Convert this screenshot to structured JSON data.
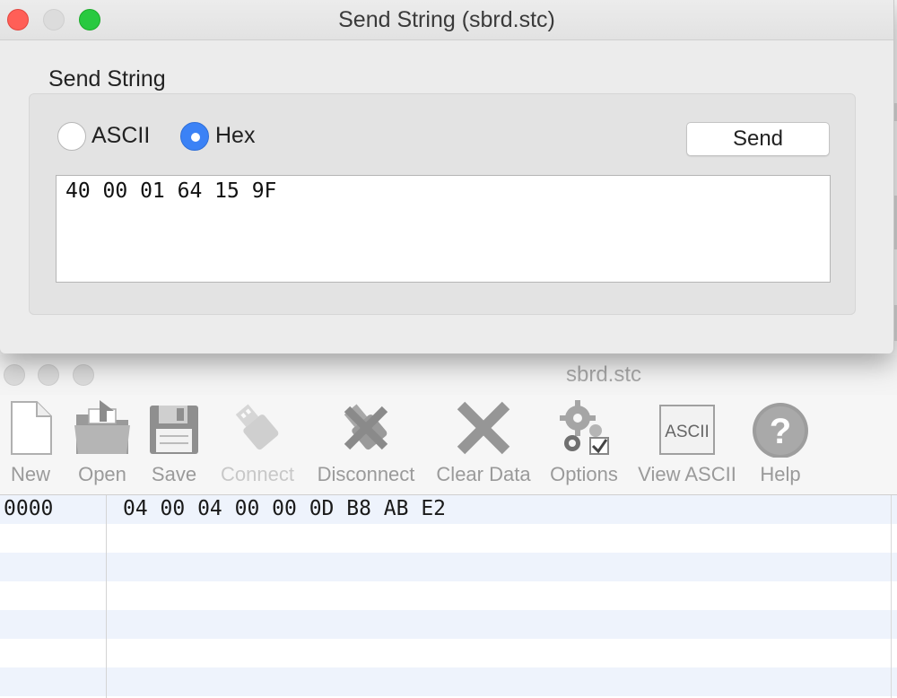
{
  "send_dialog": {
    "title": "Send String (sbrd.stc)",
    "group_label": "Send String",
    "mode_options": [
      {
        "label": "ASCII",
        "selected": false
      },
      {
        "label": "Hex",
        "selected": true
      }
    ],
    "send_label": "Send",
    "input_value": "40 00 01 64 15 9F"
  },
  "main_window": {
    "title": "sbrd.stc",
    "toolbar": [
      {
        "label": "New",
        "icon": "new-document-icon",
        "enabled": true
      },
      {
        "label": "Open",
        "icon": "open-folder-icon",
        "enabled": true
      },
      {
        "label": "Save",
        "icon": "floppy-disk-icon",
        "enabled": true
      },
      {
        "label": "Connect",
        "icon": "usb-plug-icon",
        "enabled": false
      },
      {
        "label": "Disconnect",
        "icon": "usb-disconnect-icon",
        "enabled": true
      },
      {
        "label": "Clear Data",
        "icon": "x-cross-icon",
        "enabled": true
      },
      {
        "label": "Options",
        "icon": "gears-icon",
        "enabled": true
      },
      {
        "label": "View ASCII",
        "icon": "ascii-icon",
        "enabled": true
      },
      {
        "label": "Help",
        "icon": "help-icon",
        "enabled": true
      }
    ],
    "ascii_icon_text": "ASCII",
    "help_icon_text": "?",
    "rows": [
      {
        "address": "0000",
        "bytes": "04 00 04 00 00 0D B8 AB E2"
      }
    ]
  }
}
